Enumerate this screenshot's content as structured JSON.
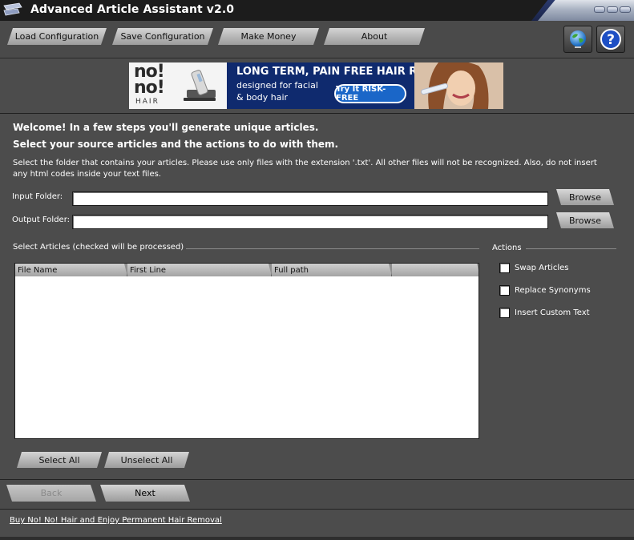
{
  "window": {
    "title": "Advanced Article Assistant v2.0"
  },
  "toolbar": {
    "buttons": [
      {
        "label": "Load Configuration"
      },
      {
        "label": "Save Configuration"
      },
      {
        "label": "Make Money"
      },
      {
        "label": "About"
      }
    ]
  },
  "banner": {
    "brand_line1": "no!",
    "brand_line2": "no!",
    "brand_hair": "HAIR",
    "headline": "LONG TERM, PAIN FREE HAIR REMOVAL",
    "sub1": "designed for facial",
    "sub2": "& body hair",
    "cta": "Try It RISK-FREE"
  },
  "main": {
    "welcome_line1": "Welcome! In a few steps you'll generate unique articles.",
    "welcome_line2": "Select your source articles and the actions to do with them.",
    "description": "Select the folder that contains your articles. Please use only files with the extension '.txt'. All other files will not be recognized. Also, do not insert any html codes inside your text files.",
    "input_folder": {
      "label": "Input Folder:",
      "value": ""
    },
    "output_folder": {
      "label": "Output Folder:",
      "value": ""
    },
    "browse_label": "Browse",
    "articles_title": "Select Articles (checked will be processed)",
    "columns": [
      "File Name",
      "First Line",
      "Full path",
      ""
    ],
    "actions_title": "Actions",
    "actions": [
      {
        "label": "Swap Articles",
        "checked": false
      },
      {
        "label": "Replace Synonyms",
        "checked": false
      },
      {
        "label": "Insert Custom Text",
        "checked": false
      }
    ],
    "select_all": "Select All",
    "unselect_all": "Unselect All"
  },
  "nav": {
    "back": "Back",
    "next": "Next"
  },
  "footer": {
    "link": "Buy No! No! Hair and Enjoy Permanent Hair Removal"
  },
  "colors": {
    "window_bg": "#4c4c4c",
    "titlebar": "#1c1c1c",
    "banner_bg": "#0f2a6e"
  }
}
